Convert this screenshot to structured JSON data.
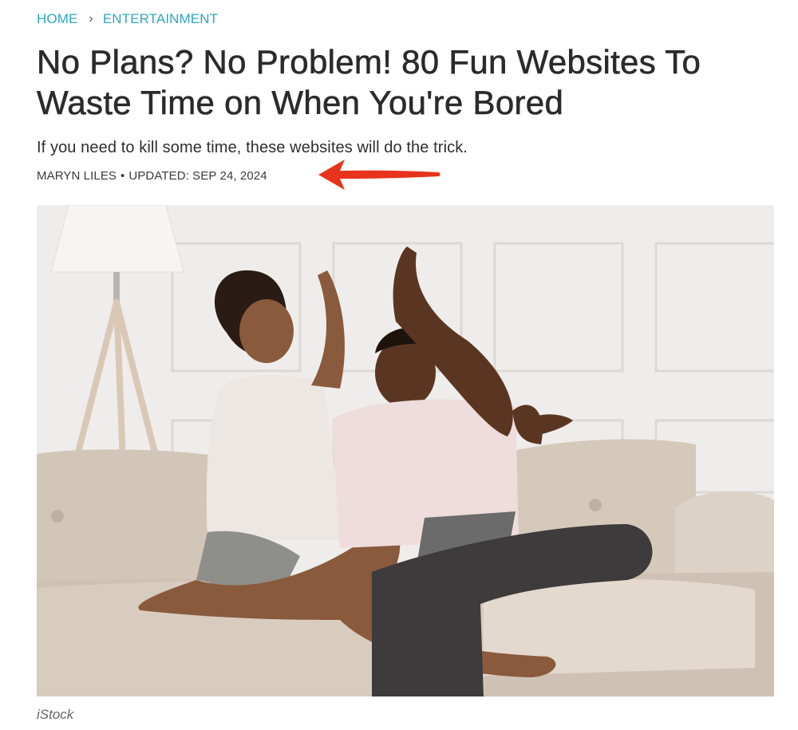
{
  "breadcrumb": {
    "home": "HOME",
    "separator": "›",
    "section": "ENTERTAINMENT"
  },
  "article": {
    "title": "No Plans? No Problem! 80 Fun Websites To Waste Time on When You're Bored",
    "dek": "If you need to kill some time, these websites will do the trick.",
    "author": "MARYN LILES",
    "updated": "UPDATED: SEP 24, 2024",
    "byline_separator": "•"
  },
  "hero_image": {
    "credit": "iStock",
    "icon": "photo-couple-high-five"
  },
  "annotation": {
    "icon": "red-arrow-icon",
    "color": "#e8331c"
  },
  "colors": {
    "link": "#2fa7c1",
    "title": "#2b2b2b"
  }
}
